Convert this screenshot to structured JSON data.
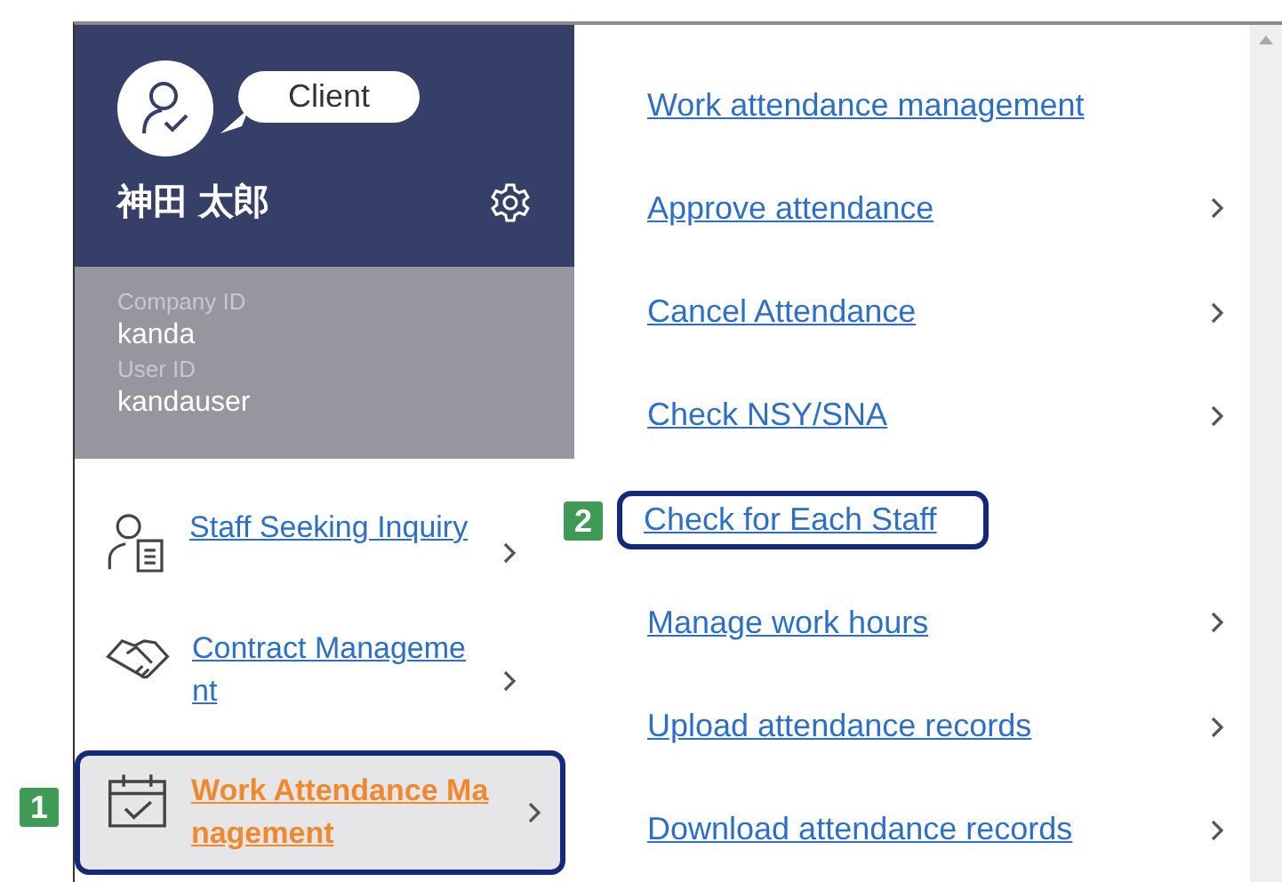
{
  "profile": {
    "role": "Client",
    "name": "神田 太郎",
    "company_id_label": "Company ID",
    "company_id": "kanda",
    "user_id_label": "User ID",
    "user_id": "kandauser"
  },
  "menu": [
    {
      "label": "Staff Seeking Inquiry",
      "kind": "inquiry",
      "selected": false
    },
    {
      "label": "Contract Management",
      "kind": "contract",
      "selected": false
    },
    {
      "label": "Work Attendance Management",
      "kind": "attendance",
      "selected": true,
      "badge": "1"
    }
  ],
  "submenu": [
    {
      "label": "Work attendance management",
      "arrow": false,
      "highlighted": false
    },
    {
      "label": "Approve attendance",
      "arrow": true,
      "highlighted": false
    },
    {
      "label": "Cancel Attendance",
      "arrow": true,
      "highlighted": false
    },
    {
      "label": "Check NSY/SNA",
      "arrow": true,
      "highlighted": false
    },
    {
      "label": "Check for Each Staff",
      "arrow": false,
      "highlighted": true,
      "badge": "2"
    },
    {
      "label": "Manage work hours",
      "arrow": true,
      "highlighted": false
    },
    {
      "label": "Upload attendance records",
      "arrow": true,
      "highlighted": false
    },
    {
      "label": "Download attendance records",
      "arrow": true,
      "highlighted": false
    }
  ]
}
